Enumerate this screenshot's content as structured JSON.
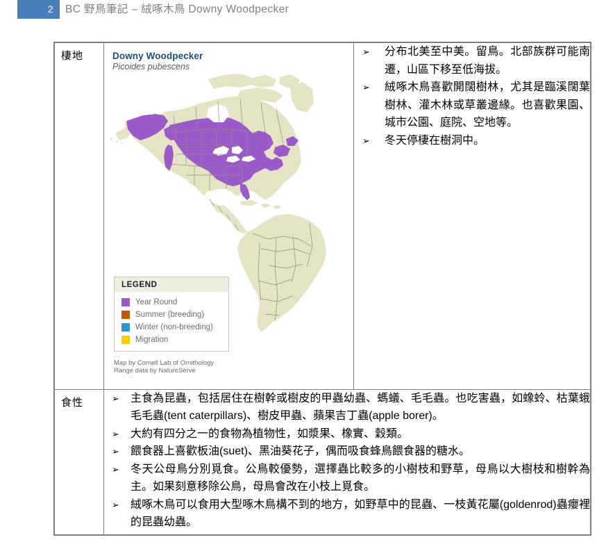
{
  "header": {
    "page_number": "2",
    "title": "BC  野鳥筆記 – 絨啄木鳥  Downy Woodpecker"
  },
  "table": {
    "rows": [
      {
        "label": "棲地"
      },
      {
        "label": "食性"
      }
    ]
  },
  "map": {
    "title": "Downy Woodpecker",
    "subtitle": "Picoides pubescens",
    "legend": {
      "heading": "LEGEND",
      "items": [
        {
          "label": "Year Round",
          "color": "#9B59C9"
        },
        {
          "label": "Summer (breeding)",
          "color": "#C2570A"
        },
        {
          "label": "Winter (non-breeding)",
          "color": "#2A95D2"
        },
        {
          "label": "Migration",
          "color": "#FFCC00"
        }
      ]
    },
    "credit_line_1": "Map by Cornell Lab of Ornithology",
    "credit_line_2": "Range data by NatureServe",
    "land_color": "#E4E4C4",
    "range_color": "#9B59C9",
    "border_color": "#8c8c7a"
  },
  "habitat": {
    "bullet_marker": "➢",
    "items": [
      "分布北美至中美。留鳥。北部族群可能南遷，山區下移至低海拔。",
      "絨啄木鳥喜歡開闊樹林，尤其是臨溪闊葉樹林、灌木林或草叢邊緣。也喜歡果園、城市公園、庭院、空地等。",
      "冬天停棲在樹洞中。"
    ]
  },
  "diet": {
    "bullet_marker": "➢",
    "items": [
      "主食為昆蟲，包括居住在樹幹或樹皮的甲蟲幼蟲、螞蟻、毛毛蟲。也吃害蟲，如蟓蛉、枯葉蛾毛毛蟲(tent caterpillars)、樹皮甲蟲、蘋果吉丁蟲(apple borer)。",
      "大約有四分之一的食物為植物性，如漿果、橡實、穀類。",
      "餵食器上喜歡板油(suet)、黑油葵花子，偶而吸食蜂鳥餵食器的糖水。",
      "冬天公母鳥分別覓食。公鳥較優勢，選擇蟲比較多的小樹枝和野草，母鳥以大樹枝和樹幹為主。如果刻意移除公鳥，母鳥會改在小枝上覓食。",
      "絨啄木鳥可以食用大型啄木鳥構不到的地方，如野草中的昆蟲、一枝黃花屬(goldenrod)蟲癭裡的昆蟲幼蟲。"
    ]
  }
}
